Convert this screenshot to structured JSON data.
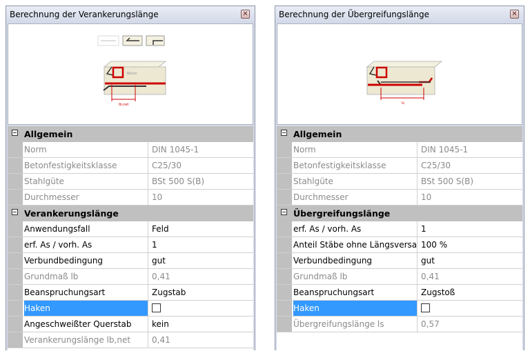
{
  "left": {
    "title": "Berechnung der Verankerungslänge",
    "close_glyph": "✕",
    "preview_label": "lb,net",
    "sections": [
      {
        "title": "Allgemein",
        "rows": [
          {
            "name": "Norm",
            "value": "DIN 1045-1",
            "readonly": true
          },
          {
            "name": "Betonfestigkeitsklasse",
            "value": "C25/30",
            "readonly": true
          },
          {
            "name": "Stahlgüte",
            "value": "BSt 500 S(B)",
            "readonly": true
          },
          {
            "name": "Durchmesser",
            "value": "10",
            "readonly": true
          }
        ]
      },
      {
        "title": "Verankerungslänge",
        "rows": [
          {
            "name": "Anwendungsfall",
            "value": "Feld",
            "readonly": false
          },
          {
            "name": "erf. As / vorh. As",
            "value": "1",
            "readonly": false
          },
          {
            "name": "Verbundbedingung",
            "value": "gut",
            "readonly": false
          },
          {
            "name": "Grundmaß lb",
            "value": "0,41",
            "readonly": true
          },
          {
            "name": "Beanspruchungsart",
            "value": "Zugstab",
            "readonly": false
          },
          {
            "name": "Haken",
            "value": "",
            "checkbox": true,
            "checked": false,
            "selected": true
          },
          {
            "name": "Angeschweißter Querstab",
            "value": "kein",
            "readonly": false
          },
          {
            "name": "Verankerungslänge lb,net",
            "value": "0,41",
            "readonly": true
          }
        ]
      }
    ]
  },
  "right": {
    "title": "Berechnung der Übergreifungslänge",
    "close_glyph": "✕",
    "preview_label": "ls",
    "sections": [
      {
        "title": "Allgemein",
        "rows": [
          {
            "name": "Norm",
            "value": "DIN 1045-1",
            "readonly": true
          },
          {
            "name": "Betonfestigkeitsklasse",
            "value": "C25/30",
            "readonly": true
          },
          {
            "name": "Stahlgüte",
            "value": "BSt 500 S(B)",
            "readonly": true
          },
          {
            "name": "Durchmesser",
            "value": "10",
            "readonly": true
          }
        ]
      },
      {
        "title": "Übergreifungslänge",
        "rows": [
          {
            "name": "erf. As / vorh. As",
            "value": "1",
            "readonly": false
          },
          {
            "name": "Anteil Stäbe ohne Längsversatz",
            "value": "100 %",
            "readonly": false
          },
          {
            "name": "Verbundbedingung",
            "value": "gut",
            "readonly": false
          },
          {
            "name": "Grundmaß lb",
            "value": "0,41",
            "readonly": true
          },
          {
            "name": "Beanspruchungsart",
            "value": "Zugstoß",
            "readonly": false
          },
          {
            "name": "Haken",
            "value": "",
            "checkbox": true,
            "checked": false,
            "selected": true
          },
          {
            "name": "Übergreifungslänge ls",
            "value": "0,57",
            "readonly": true
          }
        ]
      }
    ]
  },
  "colors": {
    "rebar": "#cc0000",
    "concrete": "#ece8d2",
    "selection": "#3399ff",
    "category_bg": "#c0c0c0"
  }
}
